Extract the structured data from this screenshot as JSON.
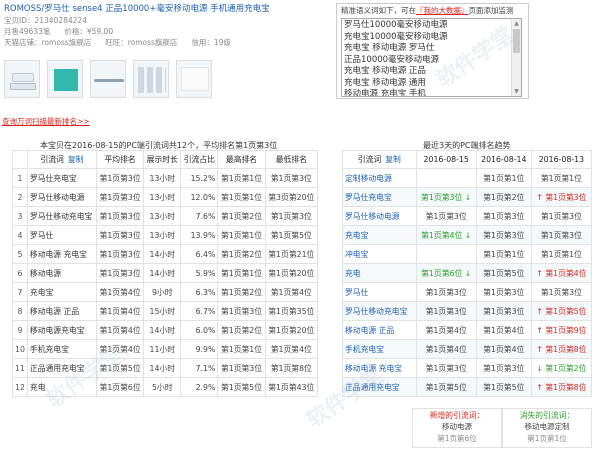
{
  "product": {
    "title": "ROMOSS/罗马仕 sense4 正品10000+毫安移动电源 手机通用充电宝",
    "item_id": "宝贝ID：21340284224",
    "sales": "月售49633笔",
    "price": "价格：¥59.00",
    "shop": "天猫店铺：romoss旗舰店",
    "wangwang": "旺旺：romoss旗舰店",
    "credit": "信用：19级"
  },
  "keyword_panel": {
    "hint_prefix": "精准语义词如下，可在",
    "hint_link": "『我的大数据』",
    "hint_suffix": "页面添加监测",
    "lines": [
      "罗马仕10000毫安移动电源",
      "充电宝10000毫安移动电源",
      "充电宝 移动电源 罗马仕",
      "正品10000毫安移动电源",
      "充电宝 移动电源 正品",
      "充电宝 移动电源 通用",
      "移动电源 充电宝 手机"
    ]
  },
  "refresh_link": "查询万词扫描最新排名>>",
  "left_table": {
    "caption": "本宝贝在2016-08-15的PC端引流词共12个，平均排名第1页第3位",
    "headers": [
      "",
      "引流词",
      "平均排名",
      "展示时长",
      "引流占比",
      "最高排名",
      "最低排名"
    ],
    "copy_label": "复制",
    "rows": [
      {
        "no": "1",
        "kw": "罗马仕充电宝",
        "avg": "第1页第3位",
        "dur": "13小时",
        "share": "15.2%",
        "hi": "第1页第1位",
        "lo": "第1页第3位"
      },
      {
        "no": "2",
        "kw": "罗马仕移动电源",
        "avg": "第1页第3位",
        "dur": "13小时",
        "share": "12.0%",
        "hi": "第1页第1位",
        "lo": "第3页第20位"
      },
      {
        "no": "3",
        "kw": "罗马仕移动充电宝",
        "avg": "第1页第3位",
        "dur": "13小时",
        "share": "7.6%",
        "hi": "第1页第2位",
        "lo": "第1页第3位"
      },
      {
        "no": "4",
        "kw": "罗马仕",
        "avg": "第1页第3位",
        "dur": "13小时",
        "share": "13.9%",
        "hi": "第1页第1位",
        "lo": "第1页第5位"
      },
      {
        "no": "5",
        "kw": "移动电源 充电宝",
        "avg": "第1页第3位",
        "dur": "14小时",
        "share": "6.4%",
        "hi": "第1页第2位",
        "lo": "第1页第21位"
      },
      {
        "no": "6",
        "kw": "移动电源",
        "avg": "第1页第3位",
        "dur": "14小时",
        "share": "5.9%",
        "hi": "第1页第1位",
        "lo": "第1页第20位"
      },
      {
        "no": "7",
        "kw": "充电宝",
        "avg": "第1页第4位",
        "dur": "9小时",
        "share": "6.3%",
        "hi": "第1页第2位",
        "lo": "第1页第4位"
      },
      {
        "no": "8",
        "kw": "移动电源 正品",
        "avg": "第1页第4位",
        "dur": "15小时",
        "share": "6.7%",
        "hi": "第1页第3位",
        "lo": "第1页第35位"
      },
      {
        "no": "9",
        "kw": "移动电源充电宝",
        "avg": "第1页第4位",
        "dur": "14小时",
        "share": "6.0%",
        "hi": "第1页第2位",
        "lo": "第1页第20位"
      },
      {
        "no": "10",
        "kw": "手机充电宝",
        "avg": "第1页第4位",
        "dur": "11小时",
        "share": "9.9%",
        "hi": "第1页第1位",
        "lo": "第1页第4位"
      },
      {
        "no": "11",
        "kw": "正品通用充电宝",
        "avg": "第1页第5位",
        "dur": "14小时",
        "share": "7.1%",
        "hi": "第1页第3位",
        "lo": "第1页第8位"
      },
      {
        "no": "12",
        "kw": "充电",
        "avg": "第1页第6位",
        "dur": "5小时",
        "share": "2.9%",
        "hi": "第1页第5位",
        "lo": "第1页第43位"
      }
    ]
  },
  "right_table": {
    "caption": "最近3天的PC端排名趋势",
    "headers": [
      "引流词",
      "2016-08-15",
      "2016-08-14",
      "2016-08-13"
    ],
    "copy_label": "复制",
    "rows": [
      {
        "kw": "定制移动电源",
        "d15": "",
        "d14": "第1页第1位",
        "d13": "第1页第1位",
        "t15": "c",
        "t14": "c",
        "t13": "c"
      },
      {
        "kw": "罗马仕充电宝",
        "d15": "第1页第3位 ↓",
        "d14": "第1页第2位",
        "d13": "↑ 第1页第3位",
        "t15": "up",
        "t14": "c",
        "t13": "down"
      },
      {
        "kw": "罗马仕移动电源",
        "d15": "第1页第3位",
        "d14": "第1页第3位",
        "d13": "第1页第3位",
        "t15": "c",
        "t14": "c",
        "t13": "c"
      },
      {
        "kw": "充电宝",
        "d15": "第1页第4位 ↓",
        "d14": "第1页第3位",
        "d13": "第1页第3位",
        "t15": "up",
        "t14": "c",
        "t13": "c"
      },
      {
        "kw": "冲电宝",
        "d15": "",
        "d14": "第1页第1位",
        "d13": "第1页第1位",
        "t15": "c",
        "t14": "c",
        "t13": "c"
      },
      {
        "kw": "充电",
        "d15": "第1页第6位 ↓",
        "d14": "第1页第5位",
        "d13": "↑ 第1页第4位",
        "t15": "up",
        "t14": "c",
        "t13": "down"
      },
      {
        "kw": "罗马仕",
        "d15": "第1页第3位",
        "d14": "第1页第3位",
        "d13": "第1页第3位",
        "t15": "c",
        "t14": "c",
        "t13": "c"
      },
      {
        "kw": "罗马仕移动充电宝",
        "d15": "第1页第3位",
        "d14": "第1页第3位",
        "d13": "↑ 第1页第5位",
        "t15": "c",
        "t14": "c",
        "t13": "down"
      },
      {
        "kw": "移动电源 正品",
        "d15": "第1页第4位",
        "d14": "第1页第4位",
        "d13": "↑ 第1页第9位",
        "t15": "c",
        "t14": "c",
        "t13": "down"
      },
      {
        "kw": "手机充电宝",
        "d15": "第1页第4位",
        "d14": "第1页第4位",
        "d13": "↑ 第1页第8位",
        "t15": "c",
        "t14": "c",
        "t13": "down"
      },
      {
        "kw": "移动电源 充电宝",
        "d15": "第1页第3位",
        "d14": "第1页第3位",
        "d13": "↓ 第1页第2位",
        "t15": "c",
        "t14": "c",
        "t13": "up"
      },
      {
        "kw": "正品通用充电宝",
        "d15": "第1页第5位",
        "d14": "第1页第5位",
        "d13": "↑ 第1页第8位",
        "t15": "c",
        "t14": "c",
        "t13": "down"
      }
    ]
  },
  "new_keywords": {
    "label": "新增的引流词：",
    "kw": "移动电源",
    "rank": "第1页第6位"
  },
  "lost_keywords": {
    "label": "消失的引流词：",
    "kw": "移动电源定制",
    "rank": "第1页第1位"
  },
  "colors": {
    "link": "#1a5fb4",
    "up": "#2a9d2a",
    "down": "#d9261c"
  }
}
